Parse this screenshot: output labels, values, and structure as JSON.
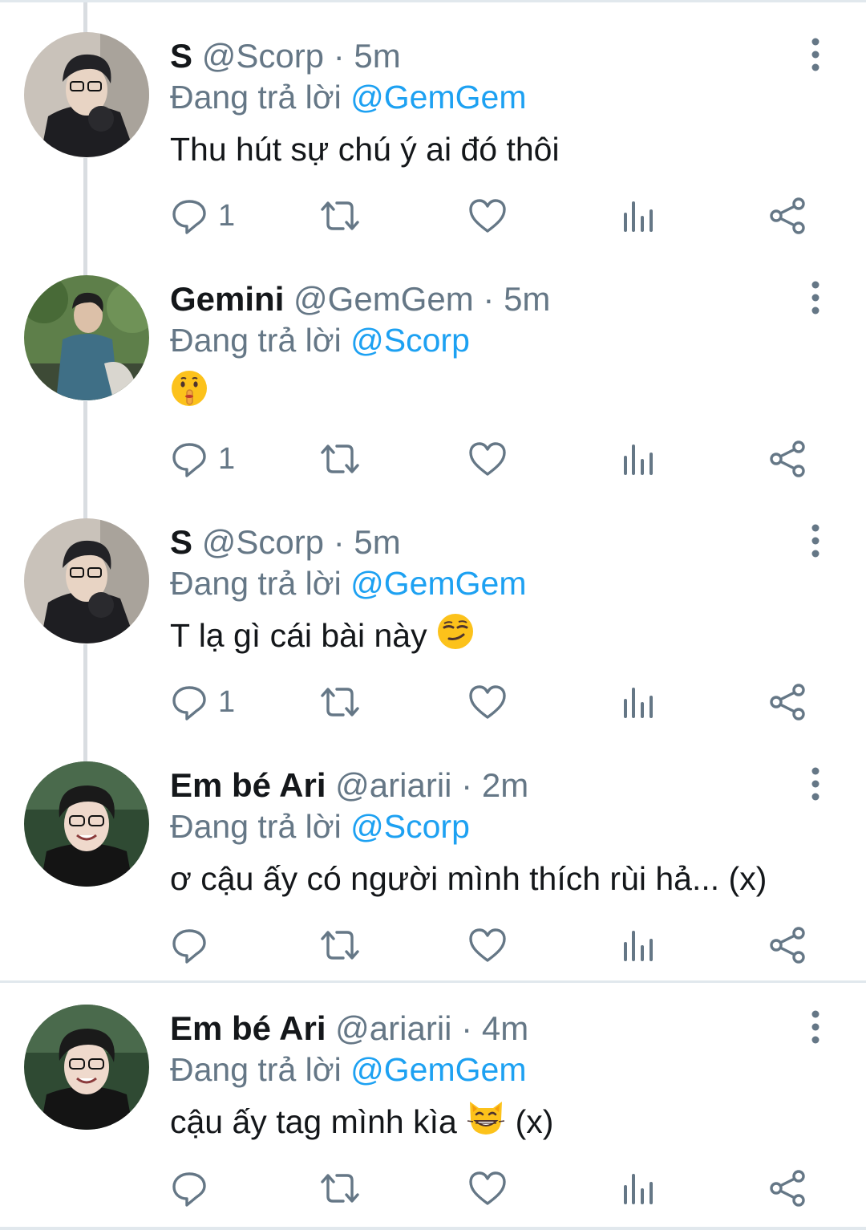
{
  "reply_prefix": "Đang trả lời",
  "tweets": [
    {
      "name": "S",
      "handle": "@Scorp",
      "separator": "·",
      "time": "5m",
      "replying_to": "@GemGem",
      "text": "Thu hút sự chú ý ai đó thôi",
      "emoji": "",
      "suffix": "",
      "reply_count": "1",
      "avatar": "avatar-dark-hair-glasses"
    },
    {
      "name": "Gemini",
      "handle": "@GemGem",
      "separator": "·",
      "time": "5m",
      "replying_to": "@Scorp",
      "text": "",
      "emoji": "shushing-face",
      "suffix": "",
      "reply_count": "1",
      "avatar": "avatar-outdoor-blue-shirt"
    },
    {
      "name": "S",
      "handle": "@Scorp",
      "separator": "·",
      "time": "5m",
      "replying_to": "@GemGem",
      "text": "T lạ gì cái bài này",
      "emoji": "smirking-face",
      "suffix": "",
      "reply_count": "1",
      "avatar": "avatar-dark-hair-glasses"
    },
    {
      "name": "Em bé Ari",
      "handle": "@ariarii",
      "separator": "·",
      "time": "2m",
      "replying_to": "@Scorp",
      "text": "ơ cậu ấy có người mình thích rùi hả... (x)",
      "emoji": "",
      "suffix": "",
      "reply_count": "",
      "avatar": "avatar-smiling-glasses"
    },
    {
      "name": "Em bé Ari",
      "handle": "@ariarii",
      "separator": "·",
      "time": "4m",
      "replying_to": "@GemGem",
      "text": "cậu ấy tag mình kìa",
      "emoji": "grinning-cat-face",
      "suffix": "(x)",
      "reply_count": "",
      "avatar": "avatar-smiling-glasses"
    }
  ],
  "icons": {
    "reply": "reply-icon",
    "retweet": "retweet-icon",
    "like": "like-icon",
    "analytics": "analytics-icon",
    "share": "share-icon",
    "more": "more-icon"
  },
  "colors": {
    "link": "#1da1f2",
    "secondary": "#657786",
    "text": "#14171a",
    "icon": "#657786"
  }
}
